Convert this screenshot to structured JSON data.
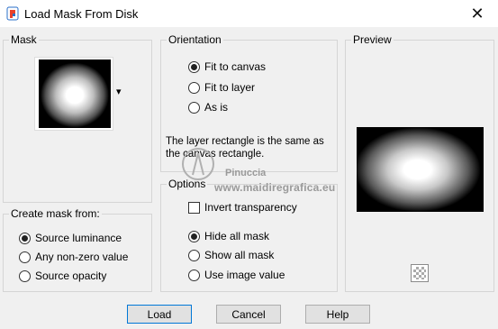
{
  "window": {
    "title": "Load Mask From Disk",
    "close_glyph": "✕"
  },
  "mask": {
    "label": "Mask",
    "dropdown_glyph": "▾"
  },
  "create_from": {
    "label": "Create mask from:",
    "options": [
      "Source luminance",
      "Any non-zero value",
      "Source opacity"
    ],
    "selected": 0
  },
  "orientation": {
    "label": "Orientation",
    "options": [
      "Fit to canvas",
      "Fit to layer",
      "As is"
    ],
    "selected": 0,
    "description_1": "The layer rectangle is the same as",
    "description_2": "the canvas rectangle."
  },
  "options": {
    "label": "Options",
    "invert_label": "Invert transparency",
    "invert_checked": false,
    "mask_options": [
      "Hide all mask",
      "Show all mask",
      "Use image value"
    ],
    "selected": 0
  },
  "preview": {
    "label": "Preview"
  },
  "buttons": {
    "load": "Load",
    "cancel": "Cancel",
    "help": "Help"
  },
  "watermark": {
    "line1": "Pinuccia",
    "line2": "www.maidiregrafica.eu"
  }
}
